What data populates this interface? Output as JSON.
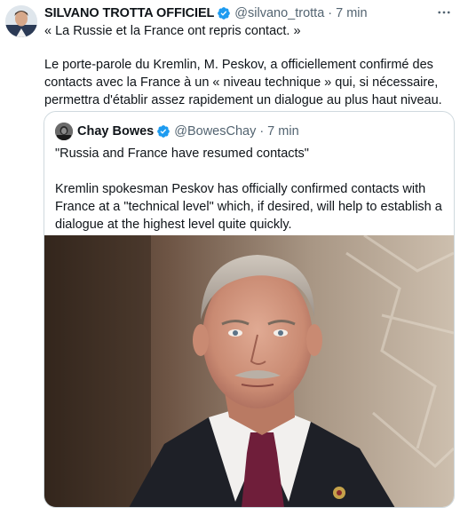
{
  "tweet": {
    "author_name": "SILVANO TROTTA OFFICIEL",
    "handle": "@silvano_trotta",
    "separator": "·",
    "time": "7 min",
    "paragraph_1": "« La Russie et la France ont repris contact. »",
    "paragraph_2": "Le porte-parole du Kremlin, M. Peskov, a officiellement confirmé des contacts avec la France à un « niveau technique » qui, si nécessaire, permettra d'établir assez rapidement un dialogue au plus haut niveau."
  },
  "quoted": {
    "author_name": "Chay Bowes",
    "handle": "@BowesChay",
    "separator": "·",
    "time": "7 min",
    "paragraph_1": "\"Russia and France have resumed contacts\"",
    "paragraph_2": "Kremlin spokesman Peskov has officially confirmed contacts with France at a \"technical level\"  which, if desired, will help to establish a dialogue at the highest level quite quickly."
  },
  "icons": {
    "verified": "verified-badge-icon",
    "more": "more-options-icon"
  },
  "colors": {
    "verified_blue": "#1d9bf0",
    "secondary_text": "#536471",
    "border": "#cfd9de"
  }
}
